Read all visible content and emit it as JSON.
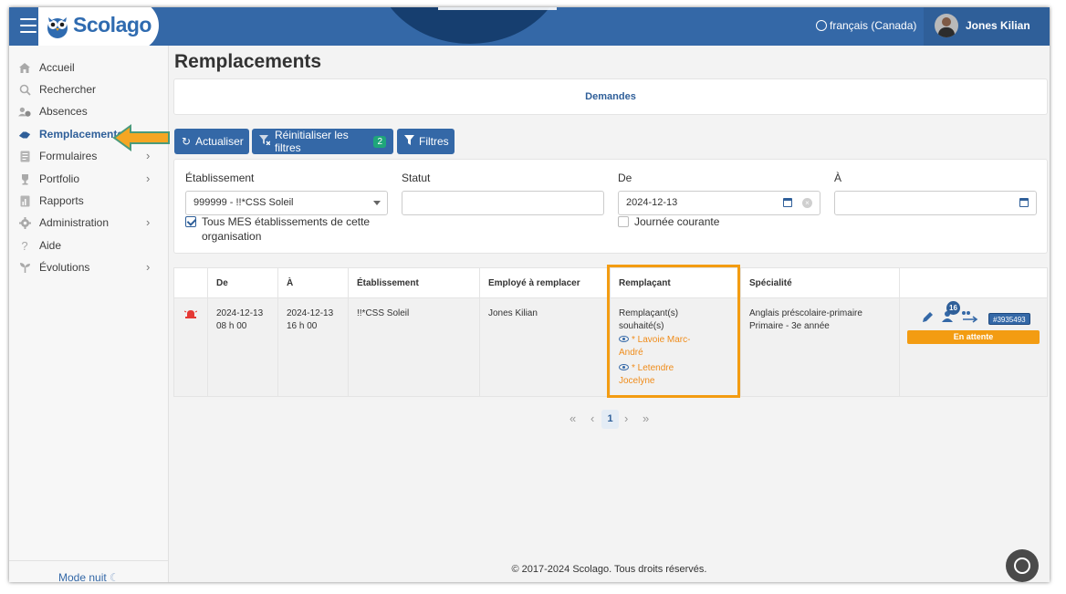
{
  "header": {
    "brand": "Scolago",
    "language": "français (Canada)",
    "user_name": "Jones Kilian"
  },
  "sidebar": {
    "items": [
      {
        "label": "Accueil",
        "icon": "home-icon"
      },
      {
        "label": "Rechercher",
        "icon": "search-icon"
      },
      {
        "label": "Absences",
        "icon": "user-clock-icon"
      },
      {
        "label": "Remplacements",
        "icon": "handshake-icon",
        "active": true
      },
      {
        "label": "Formulaires",
        "icon": "document-icon",
        "has_submenu": true
      },
      {
        "label": "Portfolio",
        "icon": "trophy-icon",
        "has_submenu": true
      },
      {
        "label": "Rapports",
        "icon": "report-icon"
      },
      {
        "label": "Administration",
        "icon": "gear-icon",
        "has_submenu": true
      },
      {
        "label": "Aide",
        "icon": "question-icon"
      },
      {
        "label": "Évolutions",
        "icon": "plant-icon",
        "has_submenu": true
      }
    ],
    "night_mode": "Mode nuit"
  },
  "page": {
    "title": "Remplacements",
    "tab": "Demandes"
  },
  "toolbar": {
    "refresh": "Actualiser",
    "reset_filters": "Réinitialiser les filtres",
    "reset_count": "2",
    "filters": "Filtres"
  },
  "filters": {
    "etablissement_label": "Établissement",
    "etablissement_value": "999999 - !!*CSS Soleil",
    "all_establishments_label_1": "Tous MES établissements de cette",
    "all_establishments_label_2": "organisation",
    "statut_label": "Statut",
    "statut_value": "",
    "de_label": "De",
    "de_value": "2024-12-13",
    "current_day_label": "Journée courante",
    "a_label": "À",
    "a_value": ""
  },
  "table": {
    "headers": [
      "De",
      "À",
      "Établissement",
      "Employé à remplacer",
      "Remplaçant",
      "Spécialité"
    ],
    "rows": [
      {
        "de_date": "2024-12-13",
        "de_time": "08 h 00",
        "a_date": "2024-12-13",
        "a_time": "16 h 00",
        "etablissement": "!!*CSS Soleil",
        "employe": "Jones Kilian",
        "remplacant_title_1": "Remplaçant(s)",
        "remplacant_title_2": "souhaité(s)",
        "remplacant_1a": "* Lavoie Marc-",
        "remplacant_1b": "André",
        "remplacant_2a": "* Letendre",
        "remplacant_2b": "Jocelyne",
        "specialite_1": "Anglais préscolaire-primaire",
        "specialite_2": "Primaire - 3e année",
        "candidates_count": "16",
        "request_id": "#3935493",
        "status": "En attente"
      }
    ]
  },
  "pagination": {
    "current": "1"
  },
  "footer": {
    "copyright": "© 2017-2024 Scolago. Tous droits réservés."
  },
  "colors": {
    "primary": "#3468a7",
    "accent_orange": "#f39c12",
    "badge_green": "#1fa67a"
  }
}
